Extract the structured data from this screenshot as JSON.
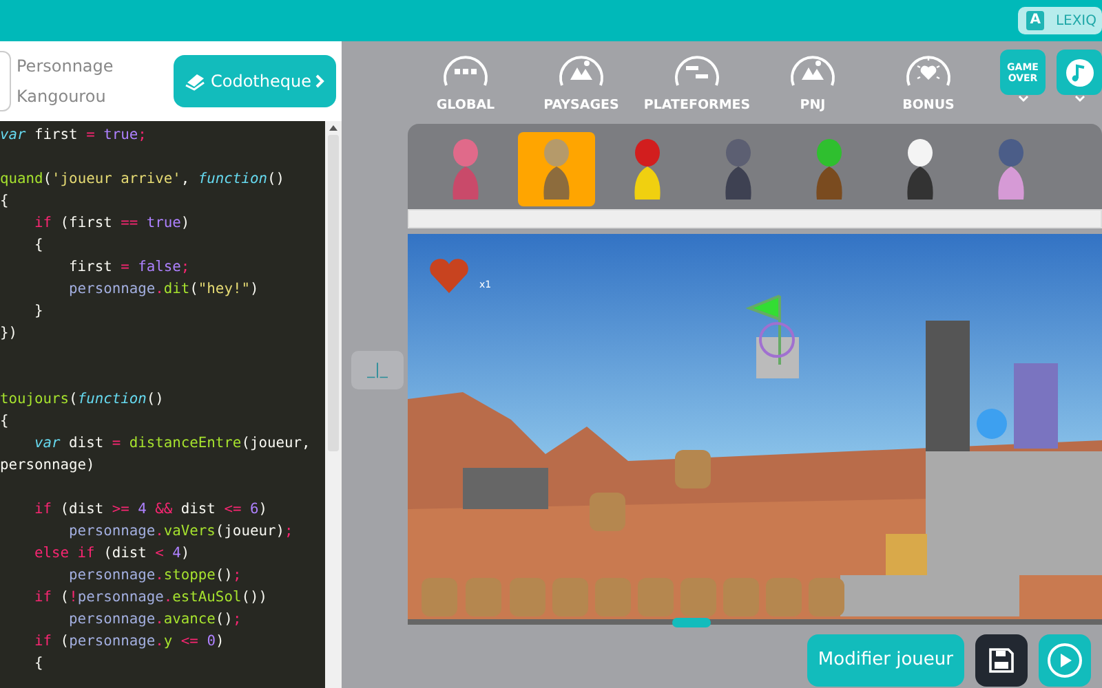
{
  "top_bar": {
    "lexicon_button": {
      "badge": "A",
      "label": "LEXIQ"
    }
  },
  "character_header": {
    "title": "Personnage",
    "name": "Kangourou"
  },
  "library_button": {
    "label": "Codotheque"
  },
  "code_lines": [
    {
      "kind": "code",
      "segments": [
        {
          "kind": "storage",
          "s": "var"
        },
        {
          "kind": "plain",
          "s": " first "
        },
        {
          "kind": "op",
          "s": "="
        },
        {
          "kind": "const",
          "s": " true"
        },
        {
          "kind": "op",
          "s": ";"
        }
      ]
    },
    {
      "kind": "blank"
    },
    {
      "kind": "code",
      "segments": [
        {
          "kind": "func",
          "s": "quand"
        },
        {
          "kind": "plain",
          "s": "("
        },
        {
          "kind": "string",
          "s": "'joueur arrive'"
        },
        {
          "kind": "plain",
          "s": ", "
        },
        {
          "kind": "storage",
          "s": "function"
        },
        {
          "kind": "plain",
          "s": "()"
        }
      ]
    },
    {
      "kind": "code",
      "segments": [
        {
          "kind": "plain",
          "s": "{"
        }
      ]
    },
    {
      "kind": "code",
      "segments": [
        {
          "kind": "keyword",
          "s": "    if"
        },
        {
          "kind": "plain",
          "s": " (first "
        },
        {
          "kind": "op",
          "s": "=="
        },
        {
          "kind": "const",
          "s": " true"
        },
        {
          "kind": "plain",
          "s": ")"
        }
      ]
    },
    {
      "kind": "code",
      "segments": [
        {
          "kind": "plain",
          "s": "    {"
        }
      ]
    },
    {
      "kind": "code",
      "segments": [
        {
          "kind": "plain",
          "s": "        first "
        },
        {
          "kind": "op",
          "s": "="
        },
        {
          "kind": "const",
          "s": " false"
        },
        {
          "kind": "op",
          "s": ";"
        }
      ]
    },
    {
      "kind": "code",
      "segments": [
        {
          "kind": "ident",
          "s": "        personnage"
        },
        {
          "kind": "op",
          "s": "."
        },
        {
          "kind": "func",
          "s": "dit"
        },
        {
          "kind": "plain",
          "s": "("
        },
        {
          "kind": "string",
          "s": "\"hey!\""
        },
        {
          "kind": "plain",
          "s": ")"
        }
      ]
    },
    {
      "kind": "code",
      "segments": [
        {
          "kind": "plain",
          "s": "    }"
        }
      ]
    },
    {
      "kind": "code",
      "segments": [
        {
          "kind": "plain",
          "s": "})"
        }
      ]
    },
    {
      "kind": "blank"
    },
    {
      "kind": "blank"
    },
    {
      "kind": "code",
      "segments": [
        {
          "kind": "func",
          "s": "toujours"
        },
        {
          "kind": "plain",
          "s": "("
        },
        {
          "kind": "storage",
          "s": "function"
        },
        {
          "kind": "plain",
          "s": "()"
        }
      ]
    },
    {
      "kind": "code",
      "segments": [
        {
          "kind": "plain",
          "s": "{"
        }
      ]
    },
    {
      "kind": "code",
      "segments": [
        {
          "kind": "storage",
          "s": "    var"
        },
        {
          "kind": "plain",
          "s": " dist "
        },
        {
          "kind": "op",
          "s": "="
        },
        {
          "kind": "func",
          "s": " distanceEntre"
        },
        {
          "kind": "plain",
          "s": "(joueur,"
        }
      ]
    },
    {
      "kind": "code",
      "segments": [
        {
          "kind": "plain",
          "s": "personnage)"
        }
      ]
    },
    {
      "kind": "blank"
    },
    {
      "kind": "code",
      "segments": [
        {
          "kind": "keyword",
          "s": "    if"
        },
        {
          "kind": "plain",
          "s": " (dist "
        },
        {
          "kind": "op",
          "s": ">="
        },
        {
          "kind": "const",
          "s": " 4"
        },
        {
          "kind": "op",
          "s": " &&"
        },
        {
          "kind": "plain",
          "s": " dist "
        },
        {
          "kind": "op",
          "s": "<="
        },
        {
          "kind": "const",
          "s": " 6"
        },
        {
          "kind": "plain",
          "s": ")"
        }
      ]
    },
    {
      "kind": "code",
      "segments": [
        {
          "kind": "ident",
          "s": "        personnage"
        },
        {
          "kind": "op",
          "s": "."
        },
        {
          "kind": "func",
          "s": "vaVers"
        },
        {
          "kind": "plain",
          "s": "(joueur)"
        },
        {
          "kind": "op",
          "s": ";"
        }
      ]
    },
    {
      "kind": "code",
      "segments": [
        {
          "kind": "keyword",
          "s": "    else if"
        },
        {
          "kind": "plain",
          "s": " (dist "
        },
        {
          "kind": "op",
          "s": "<"
        },
        {
          "kind": "const",
          "s": " 4"
        },
        {
          "kind": "plain",
          "s": ")"
        }
      ]
    },
    {
      "kind": "code",
      "segments": [
        {
          "kind": "ident",
          "s": "        personnage"
        },
        {
          "kind": "op",
          "s": "."
        },
        {
          "kind": "func",
          "s": "stoppe"
        },
        {
          "kind": "plain",
          "s": "()"
        },
        {
          "kind": "op",
          "s": ";"
        }
      ]
    },
    {
      "kind": "code",
      "segments": [
        {
          "kind": "keyword",
          "s": "    if"
        },
        {
          "kind": "plain",
          "s": " ("
        },
        {
          "kind": "op",
          "s": "!"
        },
        {
          "kind": "ident",
          "s": "personnage"
        },
        {
          "kind": "op",
          "s": "."
        },
        {
          "kind": "func",
          "s": "estAuSol"
        },
        {
          "kind": "plain",
          "s": "())"
        }
      ]
    },
    {
      "kind": "code",
      "segments": [
        {
          "kind": "ident",
          "s": "        personnage"
        },
        {
          "kind": "op",
          "s": "."
        },
        {
          "kind": "func",
          "s": "avance"
        },
        {
          "kind": "plain",
          "s": "()"
        },
        {
          "kind": "op",
          "s": ";"
        }
      ]
    },
    {
      "kind": "code",
      "segments": [
        {
          "kind": "keyword",
          "s": "    if"
        },
        {
          "kind": "plain",
          "s": " ("
        },
        {
          "kind": "ident",
          "s": "personnage"
        },
        {
          "kind": "op",
          "s": "."
        },
        {
          "kind": "func",
          "s": "y"
        },
        {
          "kind": "op",
          "s": " <="
        },
        {
          "kind": "const",
          "s": " 0"
        },
        {
          "kind": "plain",
          "s": ")"
        }
      ]
    },
    {
      "kind": "code",
      "segments": [
        {
          "kind": "plain",
          "s": "    {"
        }
      ]
    }
  ],
  "snap_button": {
    "label": "_|_"
  },
  "categories": [
    {
      "kind": "global",
      "label": "GLOBAL"
    },
    {
      "kind": "landscape",
      "label": "PAYSAGES"
    },
    {
      "kind": "platform",
      "label": "PLATEFORMES"
    },
    {
      "kind": "landscape",
      "label": "PNJ"
    },
    {
      "kind": "bonus",
      "label": "BONUS"
    }
  ],
  "game_over_button": {
    "text": "GAME OVER"
  },
  "sprites": [
    {
      "selected": false
    },
    {
      "selected": true
    },
    {
      "selected": false
    },
    {
      "selected": false
    },
    {
      "selected": false
    },
    {
      "selected": false
    },
    {
      "selected": false
    }
  ],
  "scene": {
    "lives": "x1"
  },
  "buttons": {
    "edit_player": "Modifier joueur"
  }
}
